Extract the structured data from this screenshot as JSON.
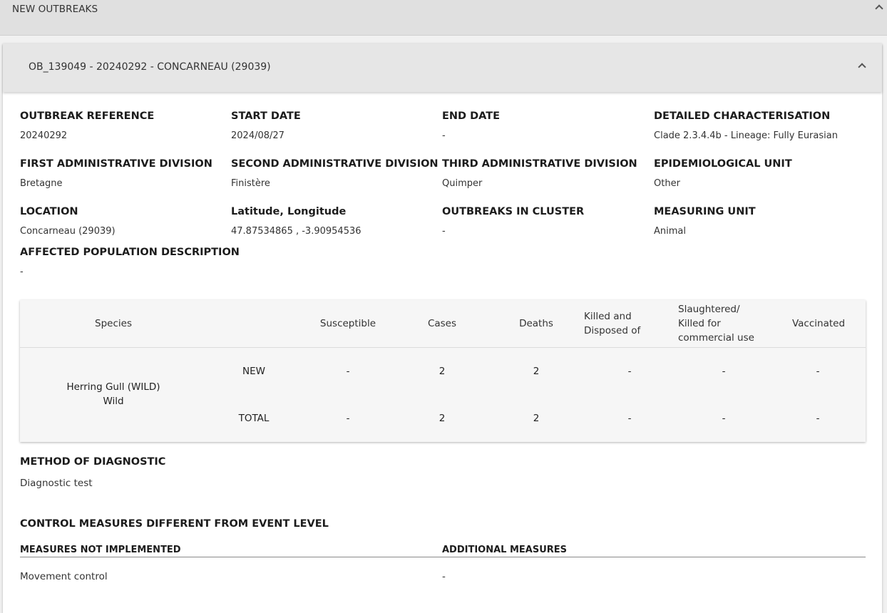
{
  "section": {
    "title": "NEW OUTBREAKS"
  },
  "outbreak": {
    "header_title": "OB_139049 - 20240292 - CONCARNEAU (29039)",
    "fields": [
      {
        "label": "OUTBREAK REFERENCE",
        "value": "20240292"
      },
      {
        "label": "START DATE",
        "value": "2024/08/27"
      },
      {
        "label": "END DATE",
        "value": "-"
      },
      {
        "label": "DETAILED CHARACTERISATION",
        "value": "Clade 2.3.4.4b - Lineage: Fully Eurasian"
      },
      {
        "label": "FIRST ADMINISTRATIVE DIVISION",
        "value": "Bretagne"
      },
      {
        "label": "SECOND ADMINISTRATIVE DIVISION",
        "value": "Finistère"
      },
      {
        "label": "THIRD ADMINISTRATIVE DIVISION",
        "value": "Quimper"
      },
      {
        "label": "EPIDEMIOLOGICAL UNIT",
        "value": "Other"
      },
      {
        "label": "LOCATION",
        "value": "Concarneau (29039)"
      },
      {
        "label": "Latitude, Longitude",
        "value": "47.87534865 , -3.90954536"
      },
      {
        "label": "OUTBREAKS IN CLUSTER",
        "value": "-"
      },
      {
        "label": "MEASURING UNIT",
        "value": "Animal"
      },
      {
        "label": "AFFECTED POPULATION DESCRIPTION",
        "value": "-"
      }
    ],
    "table": {
      "columns": [
        "Species",
        "Susceptible",
        "Cases",
        "Deaths",
        "Killed and Disposed of",
        "Slaughtered/ Killed for commercial use",
        "Vaccinated"
      ],
      "species_name": "Herring Gull (WILD)",
      "species_type": "Wild",
      "rows": [
        {
          "label": "NEW",
          "values": [
            "-",
            "2",
            "2",
            "-",
            "-",
            "-"
          ]
        },
        {
          "label": "TOTAL",
          "values": [
            "-",
            "2",
            "2",
            "-",
            "-",
            "-"
          ]
        }
      ]
    },
    "diagnostic": {
      "title": "METHOD OF DIAGNOSTIC",
      "value": "Diagnostic test"
    },
    "control_measures": {
      "title": "CONTROL MEASURES DIFFERENT FROM EVENT LEVEL",
      "not_implemented_label": "MEASURES NOT IMPLEMENTED",
      "additional_label": "ADDITIONAL MEASURES",
      "not_implemented_value": "Movement control",
      "additional_value": "-"
    }
  }
}
